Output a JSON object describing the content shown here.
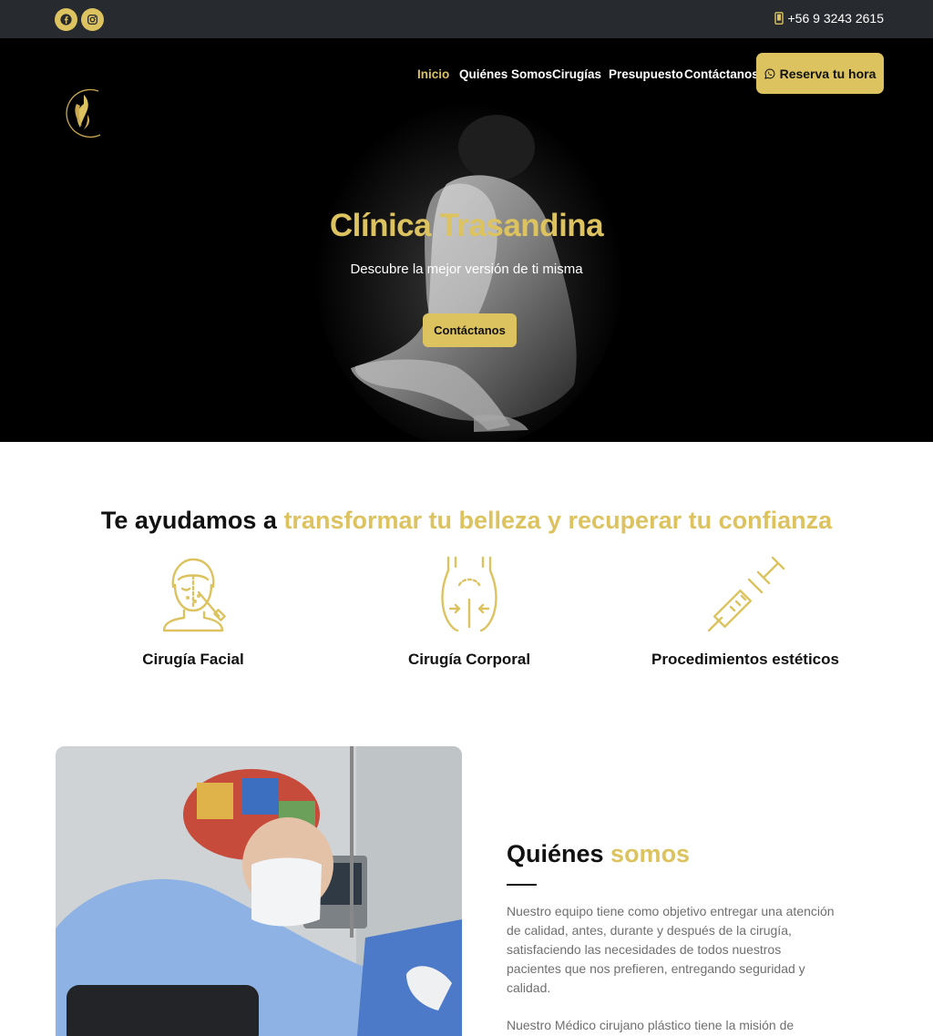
{
  "topbar": {
    "social": [
      {
        "icon": "facebook-icon"
      },
      {
        "icon": "instagram-icon"
      }
    ],
    "phone_icon": "mobile-phone-icon",
    "phone": "+56 9 3243 2615"
  },
  "nav": {
    "logo_icon": "clinica-trasandina-logo",
    "items": [
      {
        "label": "Inicio",
        "active": true
      },
      {
        "label": "Quiénes Somos",
        "active": false
      },
      {
        "label": "Cirugías",
        "active": false
      },
      {
        "label": "Presupuesto",
        "active": false
      },
      {
        "label": "Contáctanos",
        "active": false
      }
    ],
    "cta_icon": "whatsapp-icon",
    "cta_label": "Reserva tu hora"
  },
  "hero": {
    "title": "Clínica Trasandina",
    "subtitle": "Descubre la mejor versión de ti misma",
    "button_label": "Contáctanos"
  },
  "services": {
    "heading_prefix": "Te ayudamos a ",
    "heading_accent": "transformar tu belleza y recuperar tu confianza",
    "items": [
      {
        "label": "Cirugía Facial",
        "icon": "facial-surgery-icon"
      },
      {
        "label": "Cirugía Corporal",
        "icon": "body-surgery-icon"
      },
      {
        "label": "Procedimientos estéticos",
        "icon": "syringe-icon"
      }
    ]
  },
  "about": {
    "title_prefix": "Quiénes ",
    "title_accent": "somos",
    "paragraph1": "Nuestro equipo tiene como objetivo entregar una atención de calidad, antes, durante y después de la cirugía, satisfaciendo las necesidades de todos nuestros pacientes que nos prefieren, entregando seguridad y calidad.",
    "paragraph2": "Nuestro Médico cirujano plástico tiene la misión de"
  },
  "colors": {
    "accent": "#dcc360",
    "topbar": "#272a2f",
    "hero_bg": "#000000",
    "body_text": "#6f6f6f"
  }
}
